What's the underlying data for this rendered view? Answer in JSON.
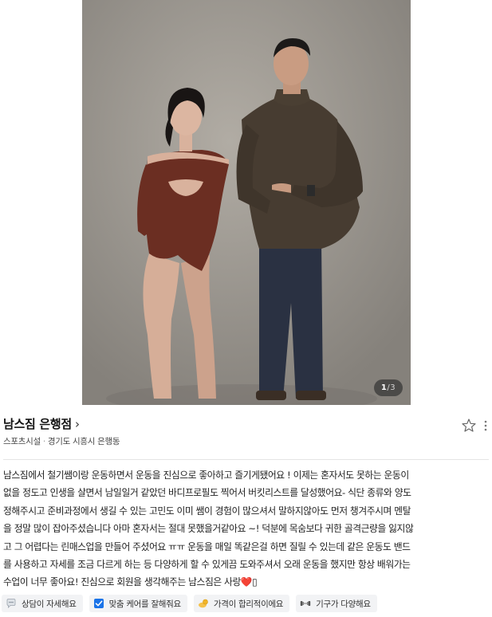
{
  "photo": {
    "alt": "",
    "page_current": "1",
    "page_separator": "/",
    "page_total": "3"
  },
  "place": {
    "name": "남스짐 은행점",
    "chevron": "›",
    "category": "스포츠시설",
    "separator": "·",
    "address": "경기도 시흥시 은행동"
  },
  "review": {
    "lines": [
      "남스짐에서 철기쌤이랑 운동하면서 운동을 진심으로 좋아하고 즐기게됐어요 ! 이제는 혼자서도 못하는 운동이",
      "없을 정도고 인생을 살면서 남일일거 같았던 바디프로필도 찍어서 버킷리스트를 달성했어요- 식단 종류와 양도",
      "정해주시고 준비과정에서 생길 수 있는 고민도 이미 쌤이 경험이 많으셔서 말하지않아도 먼저 챙겨주시며 멘탈",
      "을 정말 많이 잡아주셨습니다 아마 혼자서는 절대 못했을거같아요 ~! 덕분에 목숨보다 귀한 골격근량을 잃지않",
      "고 그 어렵다는 린매스업을 만들어 주셨어요 ㅠㅠ 운동을 매일 똑같은걸 하면 질릴 수 있는데 같은 운동도 밴드",
      "를 사용하고 자세를 조금 다르게 하는 등 다양하게 할 수 있게끔 도와주셔서 오래 운동을 했지만 항상 배워가는",
      "수업이 너무 좋아요! 진심으로 회원을 생각해주는 남스짐은 사랑❤️▯"
    ]
  },
  "tags": [
    {
      "label": "상담이 자세해요",
      "icon": "speech-bubble-icon"
    },
    {
      "label": "맞춤 케어를 잘해줘요",
      "icon": "checkbox-icon"
    },
    {
      "label": "가격이 합리적이에요",
      "icon": "coin-hand-icon"
    },
    {
      "label": "기구가 다양해요",
      "icon": "dumbbell-icon"
    }
  ],
  "colors": {
    "accent_blue": "#1a73e8",
    "photo_bg": "#9a9690",
    "tag_bg": "#f2f3f5"
  }
}
